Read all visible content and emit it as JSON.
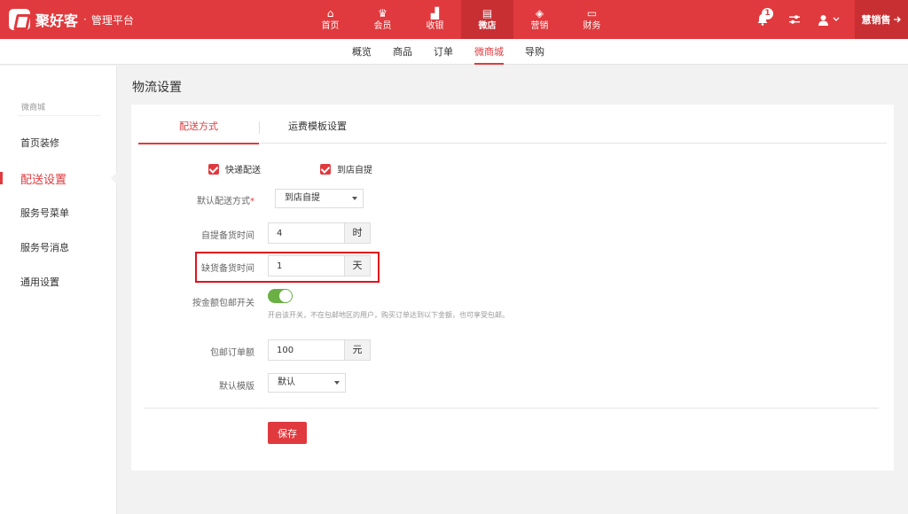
{
  "brand": {
    "name": "聚好客",
    "separator": "·",
    "subtitle": "管理平台"
  },
  "top_nav": [
    {
      "label": "首页",
      "icon": "home-icon",
      "glyph": "⌂"
    },
    {
      "label": "会员",
      "icon": "crown-icon",
      "glyph": "♛"
    },
    {
      "label": "收银",
      "icon": "cashier-icon",
      "glyph": "▟"
    },
    {
      "label": "微店",
      "icon": "store-icon",
      "glyph": "▤",
      "active": true
    },
    {
      "label": "营销",
      "icon": "box-icon",
      "glyph": "◈"
    },
    {
      "label": "财务",
      "icon": "card-icon",
      "glyph": "▭"
    }
  ],
  "top_right": {
    "notification_count": "1",
    "user": "慧销售"
  },
  "sub_nav": [
    {
      "label": "概览"
    },
    {
      "label": "商品"
    },
    {
      "label": "订单"
    },
    {
      "label": "微商城",
      "active": true
    },
    {
      "label": "导购"
    }
  ],
  "sidebar": {
    "header": "微商城",
    "items": [
      {
        "label": "首页装修"
      },
      {
        "label": "配送设置",
        "active": true
      },
      {
        "label": "服务号菜单"
      },
      {
        "label": "服务号消息"
      },
      {
        "label": "通用设置"
      }
    ]
  },
  "page": {
    "title": "物流设置"
  },
  "tabs": [
    {
      "label": "配送方式",
      "active": true
    },
    {
      "label": "运费模板设置"
    }
  ],
  "form": {
    "express_delivery": {
      "label": "快递配送",
      "checked": true
    },
    "store_pickup": {
      "label": "到店自提",
      "checked": true
    },
    "default_method": {
      "label": "默认配送方式",
      "required_mark": "*",
      "value": "到店自提"
    },
    "pickup_prep_time": {
      "label": "自提备货时间",
      "value": "4",
      "unit": "时"
    },
    "shortage_prep_time": {
      "label": "缺货备货时间",
      "value": "1",
      "unit": "天"
    },
    "free_shipping_switch": {
      "label": "按金额包邮开关",
      "on": true,
      "hint": "开启该开关，不在包邮地区的用户，购买订单达到以下金额，也可享受包邮。"
    },
    "free_shipping_amount": {
      "label": "包邮订单额",
      "value": "100",
      "unit": "元"
    },
    "default_template": {
      "label": "默认模版",
      "value": "默认"
    },
    "save_label": "保存"
  },
  "colors": {
    "brand_red": "#e03a3e",
    "toggle_green": "#6ab045",
    "highlight_red": "#e0141e"
  }
}
